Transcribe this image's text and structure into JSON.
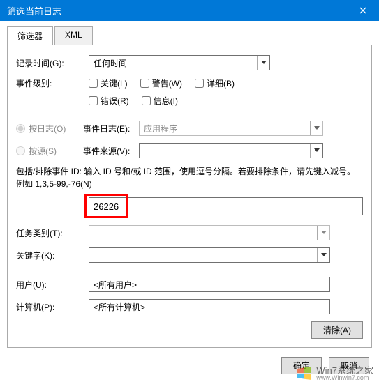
{
  "title": "筛选当前日志",
  "tabs": {
    "filter": "筛选器",
    "xml": "XML"
  },
  "form": {
    "log_time_label": "记录时间(G):",
    "log_time_value": "任何时间",
    "event_level_label": "事件级别:",
    "levels": {
      "critical": "关键(L)",
      "warning": "警告(W)",
      "verbose": "详细(B)",
      "error": "错误(R)",
      "info": "信息(I)"
    },
    "by_log_label": "按日志(O)",
    "event_log_label": "事件日志(E):",
    "event_log_value": "应用程序",
    "by_source_label": "按源(S)",
    "event_source_label": "事件来源(V):",
    "event_source_value": "",
    "id_hint": "包括/排除事件 ID: 输入 ID 号和/或 ID 范围，使用逗号分隔。若要排除条件，请先键入减号。例如 1,3,5-99,-76(N)",
    "id_value": "26226",
    "task_cat_label": "任务类别(T):",
    "task_cat_value": "",
    "keyword_label": "关键字(K):",
    "keyword_value": "",
    "user_label": "用户(U):",
    "user_value": "<所有用户>",
    "computer_label": "计算机(P):",
    "computer_value": "<所有计算机>"
  },
  "buttons": {
    "clear": "清除(A)",
    "ok": "确定",
    "cancel": "取消"
  },
  "watermark": {
    "name": "Win7系统之家",
    "url": "www.Winwin7.com"
  }
}
